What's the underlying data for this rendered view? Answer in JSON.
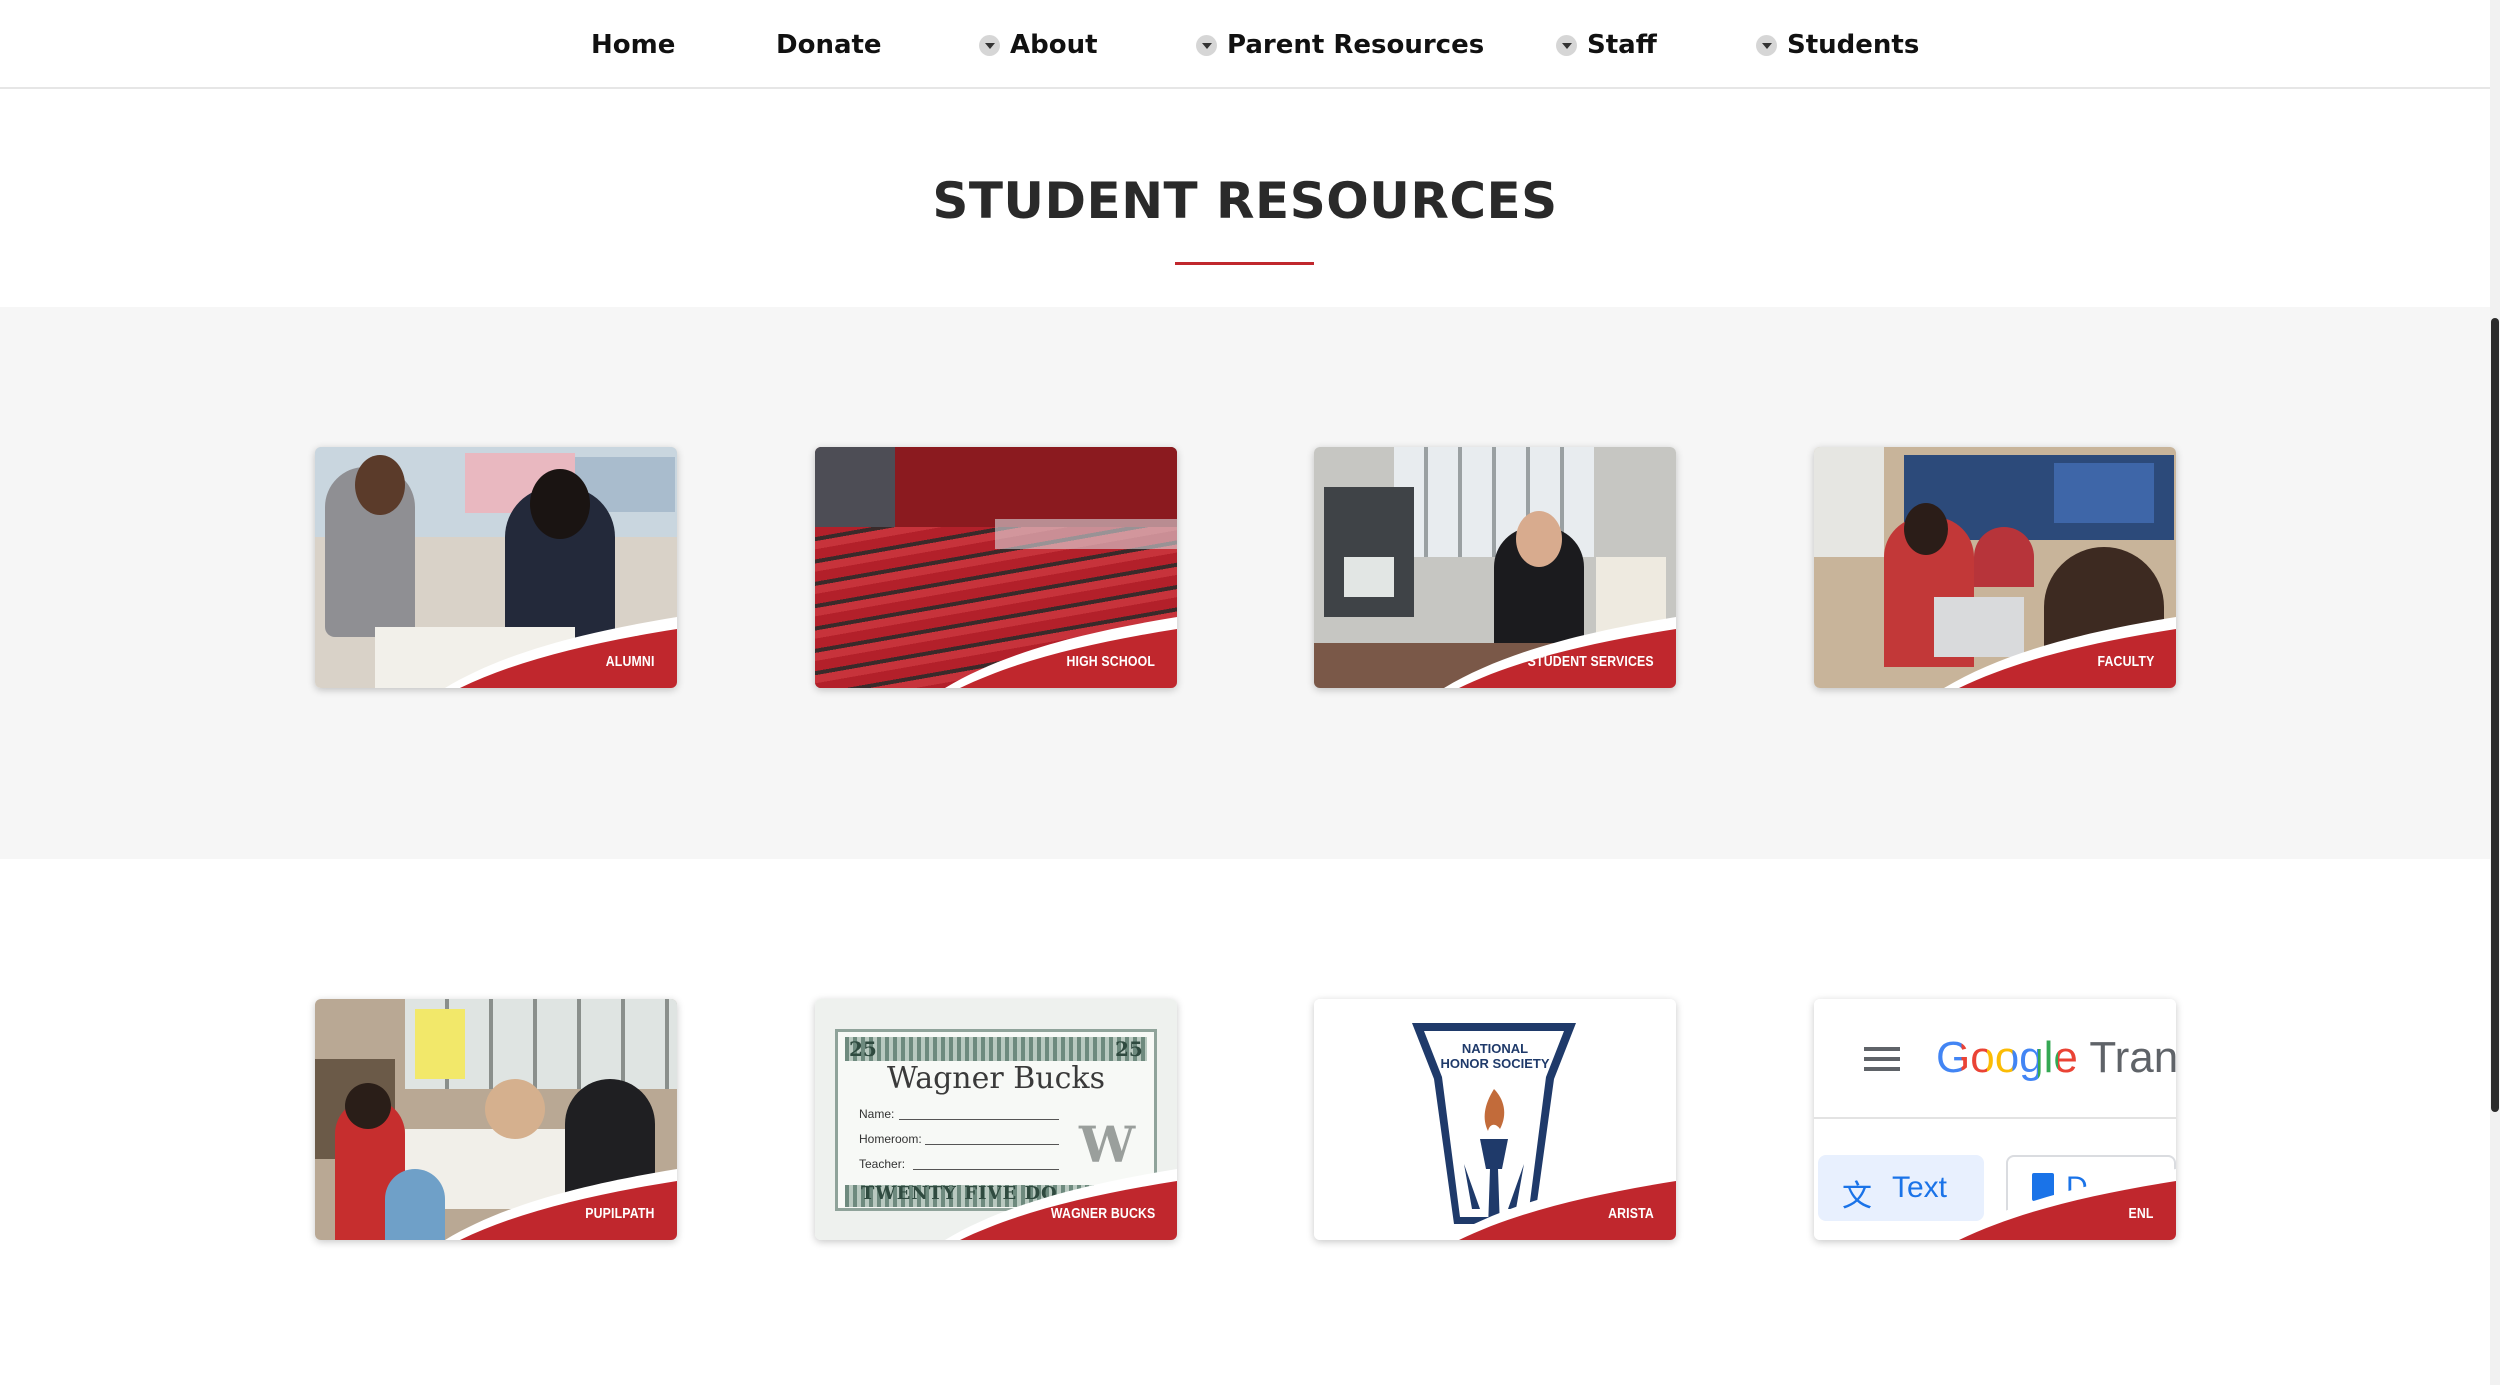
{
  "nav": {
    "items": [
      {
        "label": "Home",
        "dropdown": false
      },
      {
        "label": "Donate",
        "dropdown": false
      },
      {
        "label": "About",
        "dropdown": true
      },
      {
        "label": "Parent Resources",
        "dropdown": true
      },
      {
        "label": "Staff",
        "dropdown": true
      },
      {
        "label": "Students",
        "dropdown": true
      }
    ]
  },
  "page": {
    "title": "STUDENT RESOURCES"
  },
  "cards": [
    {
      "label": "ALUMNI"
    },
    {
      "label": "HIGH SCHOOL"
    },
    {
      "label": "STUDENT SERVICES"
    },
    {
      "label": "FACULTY"
    },
    {
      "label": "PUPILPATH"
    },
    {
      "label": "WAGNER BUCKS"
    },
    {
      "label": "ARISTA"
    },
    {
      "label": "ENL"
    }
  ],
  "wagner_bucks": {
    "denomination": "25",
    "heading": "Wagner Bucks",
    "fields": [
      "Name:",
      "Homeroom:",
      "Teacher:"
    ],
    "footer": "TWENTY FIVE DO",
    "mark": "W"
  },
  "arista": {
    "line1": "NATIONAL",
    "line2": "HONOR SOCIETY"
  },
  "enl": {
    "brand": "Google",
    "brand_suffix": "Trans",
    "tab": "Text",
    "tab2": "D"
  },
  "colors": {
    "accent": "#c0272d",
    "band_grey": "#f6f6f6"
  }
}
